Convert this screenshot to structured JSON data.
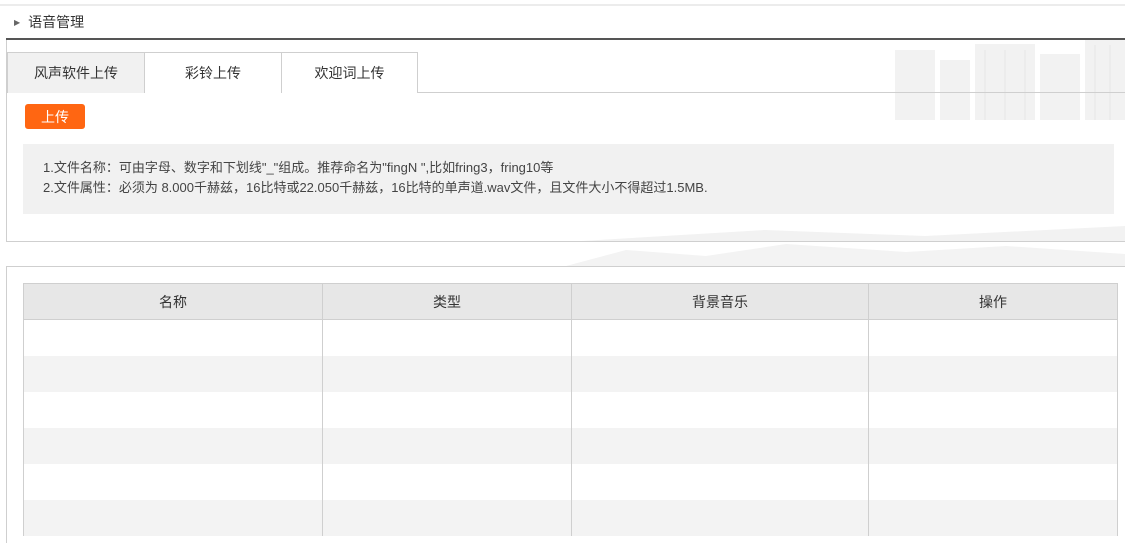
{
  "breadcrumb": {
    "title": "语音管理"
  },
  "tabs": [
    {
      "label": "风声软件上传",
      "active": true
    },
    {
      "label": "彩铃上传",
      "active": false
    },
    {
      "label": "欢迎词上传",
      "active": false
    }
  ],
  "upload_button": {
    "label": "上传"
  },
  "notes": {
    "line1": "1.文件名称：可由字母、数字和下划线\"_\"组成。推荐命名为\"fingN \",比如fring3，fring10等",
    "line2": "2.文件属性：必须为 8.000千赫兹，16比特或22.050千赫兹，16比特的单声道.wav文件，且文件大小不得超过1.5MB."
  },
  "table": {
    "columns": [
      "名称",
      "类型",
      "背景音乐",
      "操作"
    ],
    "rows": []
  },
  "colors": {
    "accent": "#ff6612",
    "header_bg": "#e7e7e7",
    "stripe": "#f3f3f3",
    "border": "#cfcfcf"
  }
}
